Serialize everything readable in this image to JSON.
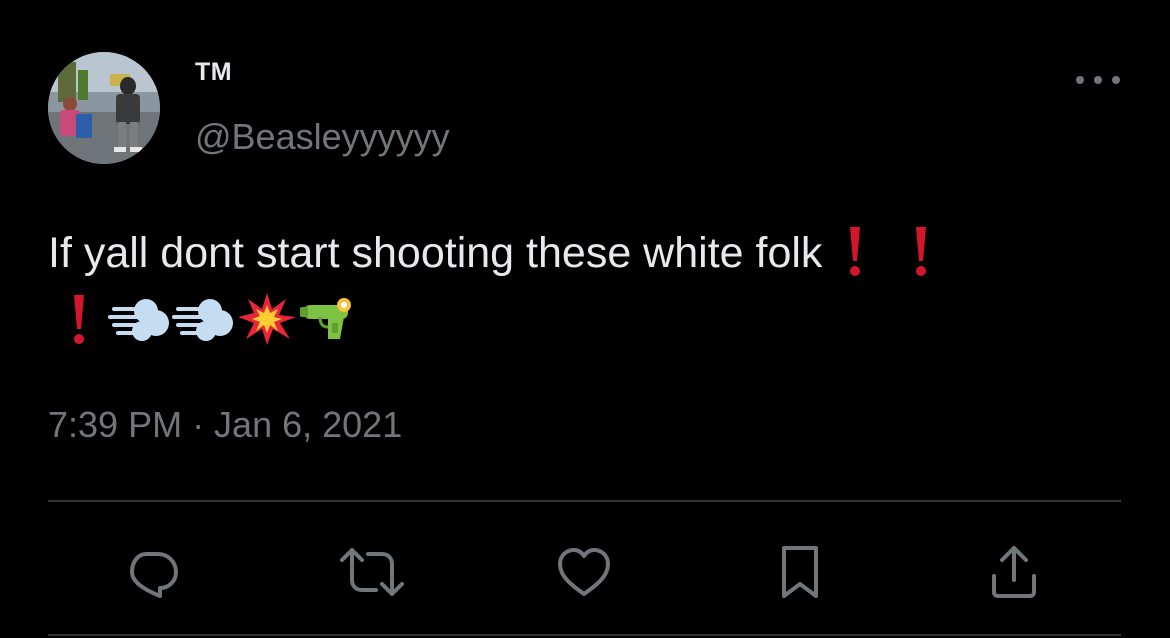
{
  "author": {
    "display_name": "TM",
    "handle": "@Beasleyyyyyy"
  },
  "tweet": {
    "text": "If yall dont start shooting these white folk",
    "emojis": [
      "red-exclamation",
      "red-exclamation",
      "red-exclamation",
      "dashing-away",
      "dashing-away",
      "collision",
      "water-pistol"
    ],
    "timestamp": "7:39 PM · Jan 6, 2021"
  },
  "actions": [
    "reply-icon",
    "retweet-icon",
    "like-icon",
    "bookmark-icon",
    "share-icon"
  ],
  "colors": {
    "background": "#000000",
    "primary_text": "#e7e9ea",
    "secondary_text": "#71767b",
    "divider": "#2f3336",
    "exclamation_red": "#d4162c"
  }
}
